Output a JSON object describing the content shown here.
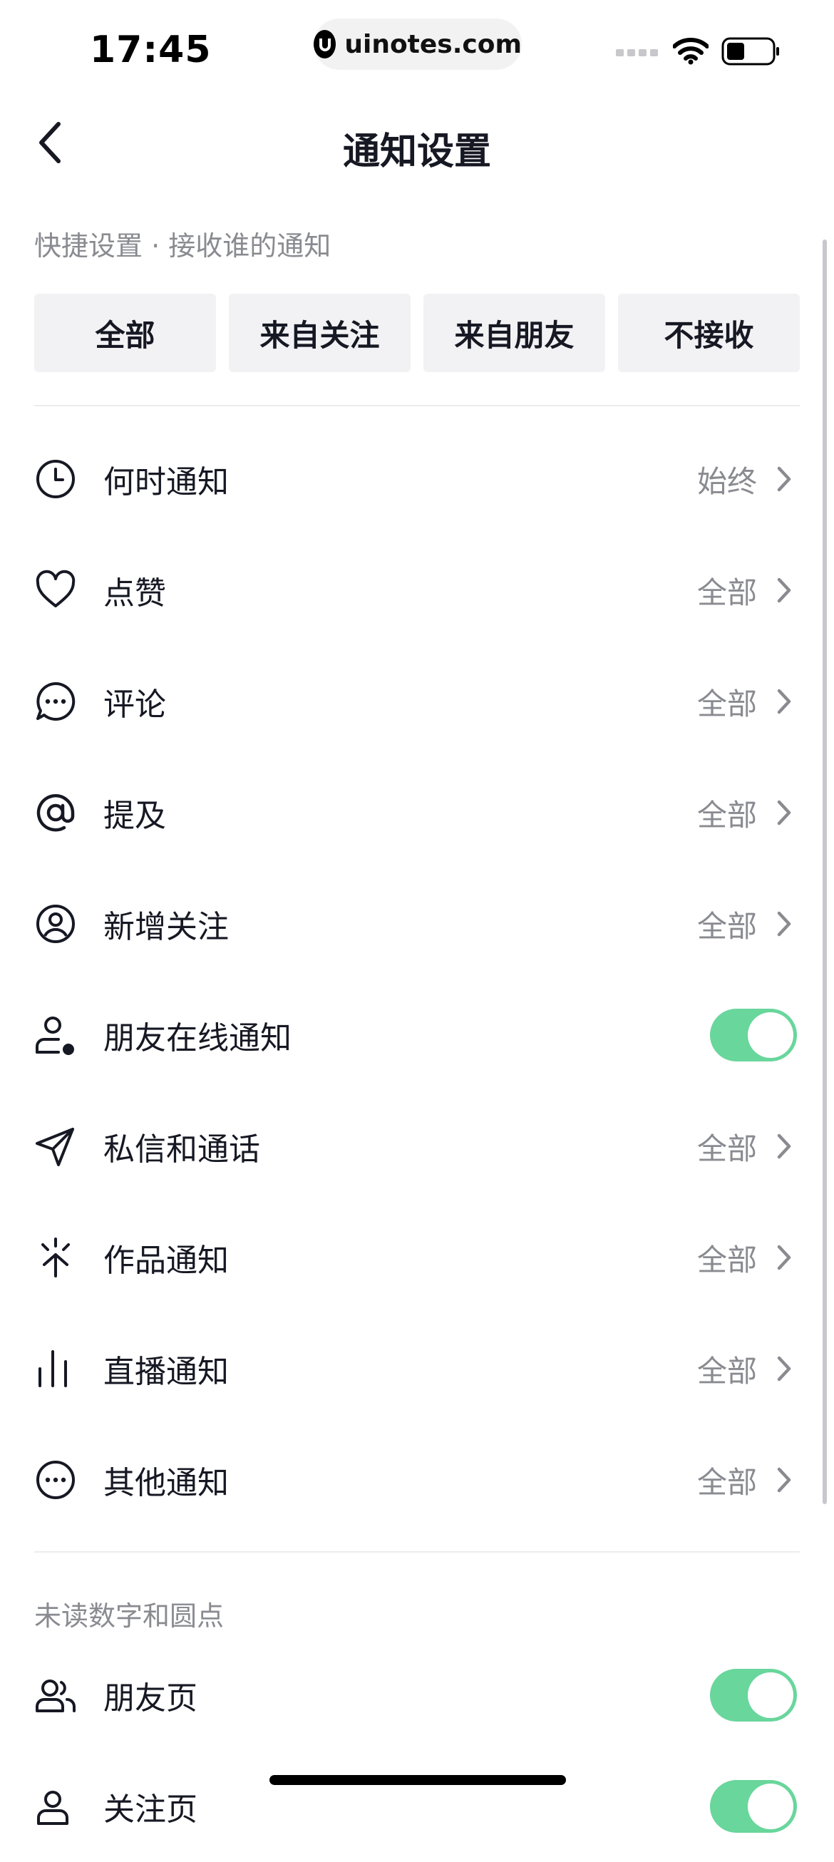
{
  "status_bar": {
    "time": "17:45",
    "url": "uinotes.com",
    "icons": [
      "signal-icon",
      "wifi-icon",
      "battery-icon"
    ]
  },
  "nav": {
    "title": "通知设置"
  },
  "quick": {
    "section_label": "快捷设置 · 接收谁的通知",
    "options": [
      "全部",
      "来自关注",
      "来自朋友",
      "不接收"
    ]
  },
  "rows": [
    {
      "label": "何时通知",
      "value": "始终",
      "icon": "clock-icon"
    },
    {
      "label": "点赞",
      "value": "全部",
      "icon": "heart-icon"
    },
    {
      "label": "评论",
      "value": "全部",
      "icon": "comment-icon"
    },
    {
      "label": "提及",
      "value": "全部",
      "icon": "at-icon"
    },
    {
      "label": "新增关注",
      "value": "全部",
      "icon": "user-circle-icon"
    },
    {
      "label": "朋友在线通知",
      "toggle": true,
      "icon": "user-online-icon"
    },
    {
      "label": "私信和通话",
      "value": "全部",
      "icon": "send-icon"
    },
    {
      "label": "作品通知",
      "value": "全部",
      "icon": "sparkle-icon"
    },
    {
      "label": "直播通知",
      "value": "全部",
      "icon": "bars-icon"
    },
    {
      "label": "其他通知",
      "value": "全部",
      "icon": "more-circle-icon"
    }
  ],
  "unread": {
    "section_label": "未读数字和圆点",
    "rows": [
      {
        "label": "朋友页",
        "toggle": true,
        "icon": "friends-icon"
      },
      {
        "label": "关注页",
        "toggle": true,
        "icon": "user-icon"
      }
    ]
  },
  "colors": {
    "toggle_on": "#69d69c",
    "text_primary": "#161823",
    "text_secondary": "#8a8b91"
  }
}
